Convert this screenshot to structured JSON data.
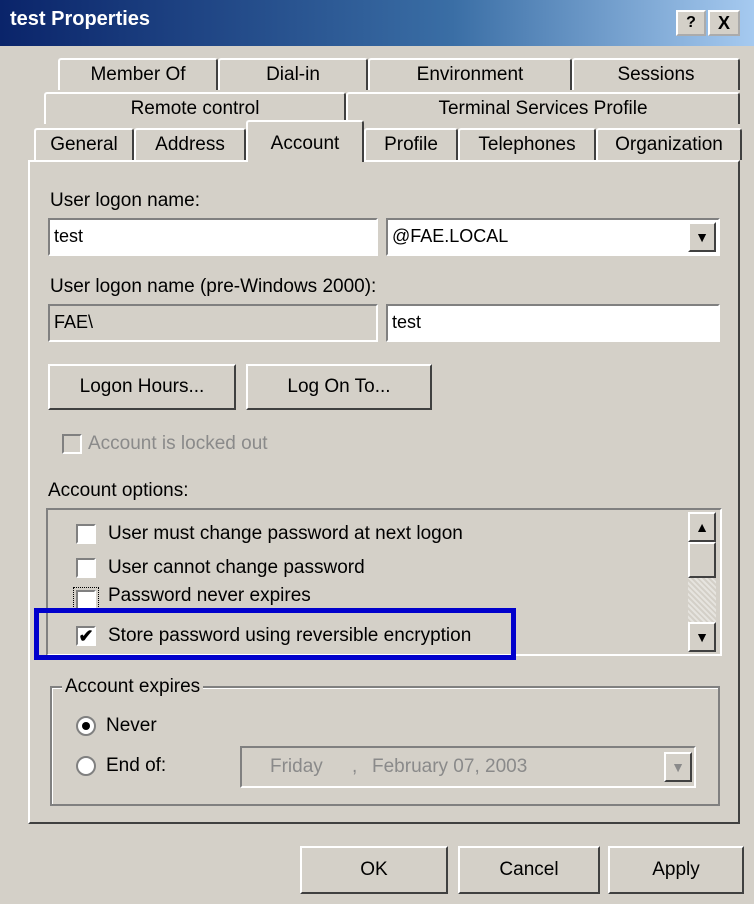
{
  "window": {
    "title": "test Properties",
    "help_label": "?",
    "close_label": "X"
  },
  "tabs": {
    "row1": [
      "Member Of",
      "Dial-in",
      "Environment",
      "Sessions"
    ],
    "row2": [
      "Remote control",
      "Terminal Services Profile"
    ],
    "row3": [
      "General",
      "Address",
      "Account",
      "Profile",
      "Telephones",
      "Organization"
    ],
    "active": "Account"
  },
  "account": {
    "logon_label": "User logon name:",
    "logon_value": "test",
    "domain_value": "@FAE.LOCAL",
    "pre2000_label": "User logon name (pre-Windows 2000):",
    "pre2000_domain": "FAE\\",
    "pre2000_value": "test",
    "logon_hours_label": "Logon Hours...",
    "logon_to_label": "Log On To...",
    "locked_out_label": "Account is locked out",
    "options_label": "Account options:",
    "options": [
      {
        "label": "User must change password at next logon",
        "checked": false
      },
      {
        "label": "User cannot change password",
        "checked": false
      },
      {
        "label": "Password never expires",
        "checked": false
      },
      {
        "label": "Store password using reversible encryption",
        "checked": true
      }
    ],
    "highlight_color": "#0000cc",
    "expires_label": "Account expires",
    "never_label": "Never",
    "endof_label": "End of:",
    "endof_day": "Friday",
    "endof_sep": ",",
    "endof_date": "February  07, 2003"
  },
  "buttons": {
    "ok": "OK",
    "cancel": "Cancel",
    "apply": "Apply"
  },
  "checkmark": "✔"
}
